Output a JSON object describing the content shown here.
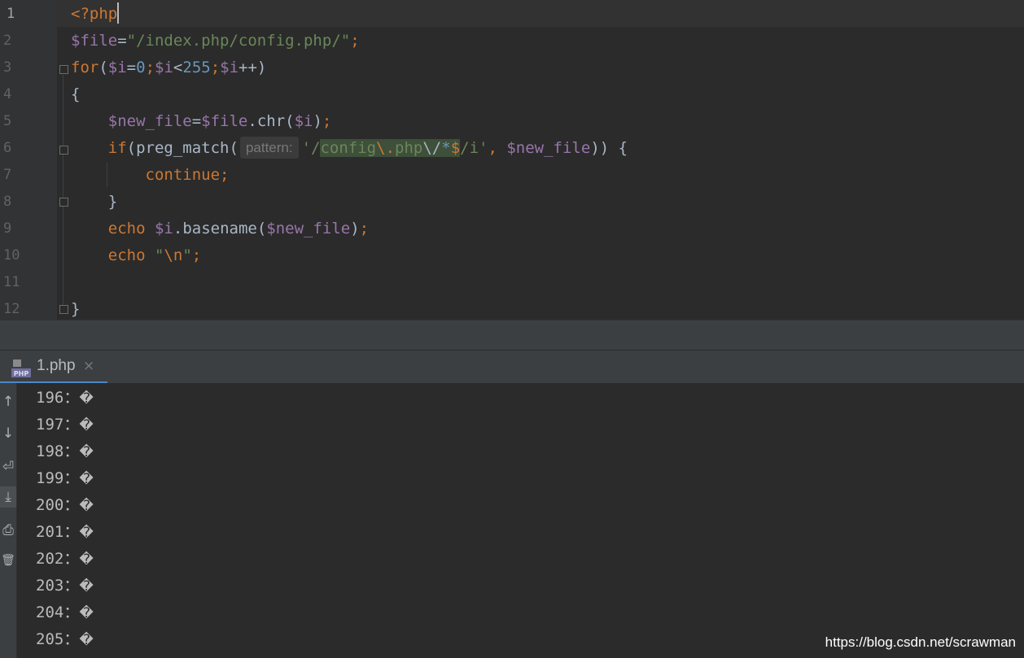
{
  "editor": {
    "line_numbers": [
      "1",
      "2",
      "3",
      "4",
      "5",
      "6",
      "7",
      "8",
      "9",
      "10",
      "11",
      "12"
    ],
    "lines": {
      "l1_open": "<?php",
      "l2_var": "$file",
      "l2_eq": "=",
      "l2_str": "\"/index.php/config.php/\"",
      "l2_semi": ";",
      "l3_for": "for",
      "l3_open": "(",
      "l3_i1": "$i",
      "l3_eq": "=",
      "l3_zero": "0",
      "l3_semi1": ";",
      "l3_i2": "$i",
      "l3_lt": "<",
      "l3_max": "255",
      "l3_semi2": ";",
      "l3_i3": "$i",
      "l3_inc": "++)",
      "l4_brace": "{",
      "l5_var": "$new_file",
      "l5_eq": "=",
      "l5_file": "$file",
      "l5_chr": ".chr(",
      "l5_i": "$i",
      "l5_close": ")",
      "l5_semi": ";",
      "l6_if": "if",
      "l6_call": "(preg_match(",
      "l6_hint": "pattern:",
      "l6_q1": "'/",
      "l6_config": "config",
      "l6_esc1": "\\.",
      "l6_php": "php",
      "l6_esc2": "\\/",
      "l6_star": "*",
      "l6_dollar": "$",
      "l6_tail": "/i'",
      "l6_comma": ", ",
      "l6_newfile": "$new_file",
      "l6_end": ")) {",
      "l7_continue": "continue",
      "l7_semi": ";",
      "l8_brace": "}",
      "l9_echo": "echo",
      "l9_i": "$i",
      "l9_call": ".basename(",
      "l9_newfile": "$new_file",
      "l9_close": ")",
      "l9_semi": ";",
      "l10_echo": "echo",
      "l10_str1": "\"",
      "l10_esc": "\\n",
      "l10_str2": "\"",
      "l10_semi": ";",
      "l12_brace": "}"
    }
  },
  "run_panel": {
    "tab_label": "1.php",
    "tab_icon": "php-file-icon",
    "close_glyph": "×",
    "tools": [
      "↑",
      "↓",
      "⏎",
      "⤓",
      "⎙",
      "🗑"
    ],
    "output": [
      {
        "num": "196",
        "sep": "：",
        "char": "�"
      },
      {
        "num": "197",
        "sep": "：",
        "char": "�"
      },
      {
        "num": "198",
        "sep": "：",
        "char": "�"
      },
      {
        "num": "199",
        "sep": "：",
        "char": "�"
      },
      {
        "num": "200",
        "sep": "：",
        "char": "�"
      },
      {
        "num": "201",
        "sep": "：",
        "char": "�"
      },
      {
        "num": "202",
        "sep": "：",
        "char": "�"
      },
      {
        "num": "203",
        "sep": "：",
        "char": "�"
      },
      {
        "num": "204",
        "sep": "：",
        "char": "�"
      },
      {
        "num": "205",
        "sep": "：",
        "char": "�"
      }
    ]
  },
  "watermark": "https://blog.csdn.net/scrawman"
}
